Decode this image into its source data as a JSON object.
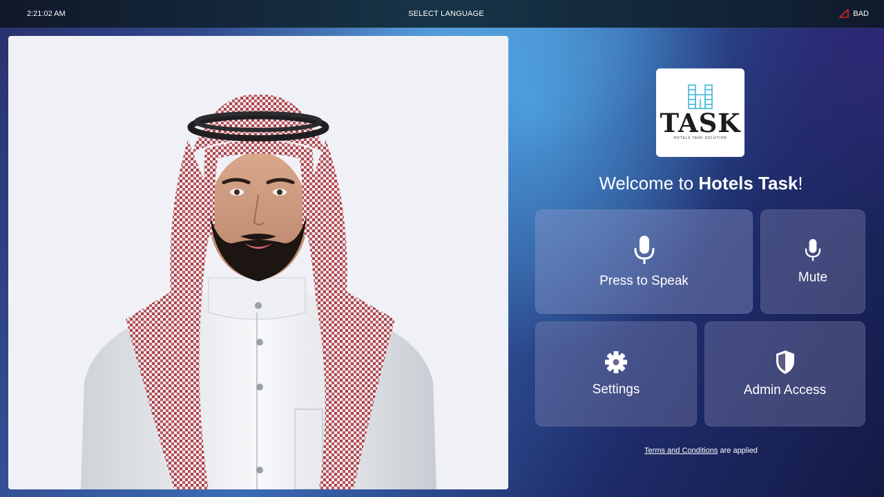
{
  "status_bar": {
    "time": "2:21:02 AM",
    "language_label": "SELECT LANGUAGE",
    "connection_status": "BAD",
    "connection_icon": "warning-triangle-icon",
    "connection_color": "#e0202a"
  },
  "logo": {
    "wordmark": "TASK",
    "tagline": "HOTELS TASK SOLUTION",
    "icon": "hotel-building-icon",
    "icon_color": "#3fb8d8"
  },
  "welcome": {
    "prefix": "Welcome to ",
    "brand": "Hotels Task",
    "suffix": "!"
  },
  "actions": {
    "speak": {
      "label": "Press to Speak",
      "icon": "microphone-icon"
    },
    "mute": {
      "label": "Mute",
      "icon": "microphone-icon"
    },
    "settings": {
      "label": "Settings",
      "icon": "gear-icon"
    },
    "admin": {
      "label": "Admin Access",
      "icon": "shield-icon"
    }
  },
  "footer": {
    "terms_link": "Terms and Conditions",
    "terms_suffix": " are applied"
  }
}
